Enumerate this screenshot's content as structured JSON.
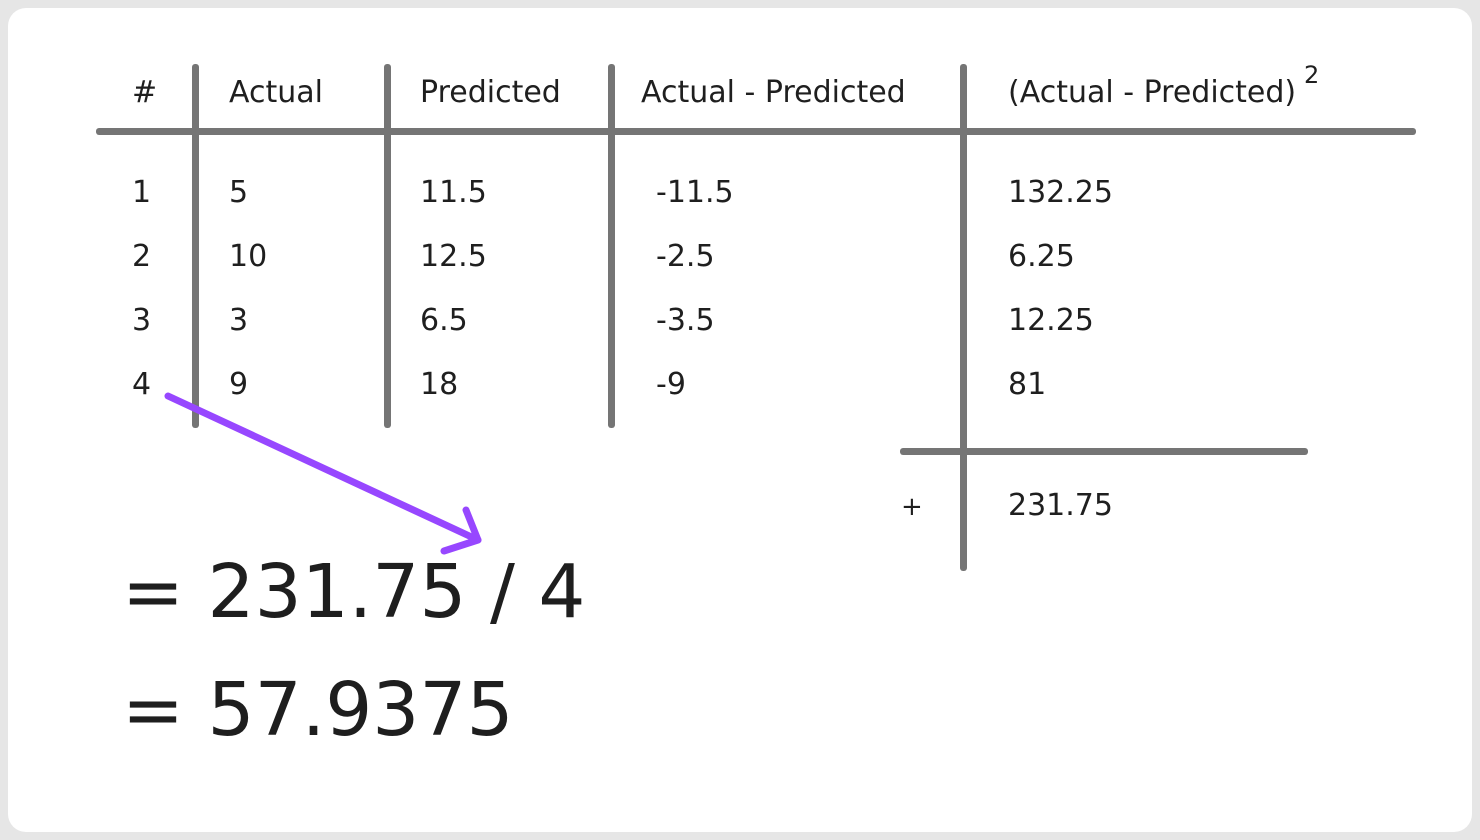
{
  "table": {
    "headers": {
      "index": "#",
      "actual": "Actual",
      "predicted": "Predicted",
      "diff": "Actual - Predicted",
      "squared": "(Actual - Predicted)",
      "squared_exp": "2"
    },
    "rows": [
      {
        "index": "1",
        "actual": "5",
        "predicted": "11.5",
        "diff": "-11.5",
        "squared": "132.25"
      },
      {
        "index": "2",
        "actual": "10",
        "predicted": "12.5",
        "diff": "-2.5",
        "squared": "6.25"
      },
      {
        "index": "3",
        "actual": "3",
        "predicted": "6.5",
        "diff": "-3.5",
        "squared": "12.25"
      },
      {
        "index": "4",
        "actual": "9",
        "predicted": "18",
        "diff": "-9",
        "squared": "81"
      }
    ],
    "sum": {
      "symbol": "+",
      "value": "231.75"
    }
  },
  "equations": {
    "line1": "= 231.75 / 4",
    "line2": "= 57.9375"
  },
  "colors": {
    "grid": "#757575",
    "arrow": "#9747ff",
    "text": "#1f1f1f"
  }
}
